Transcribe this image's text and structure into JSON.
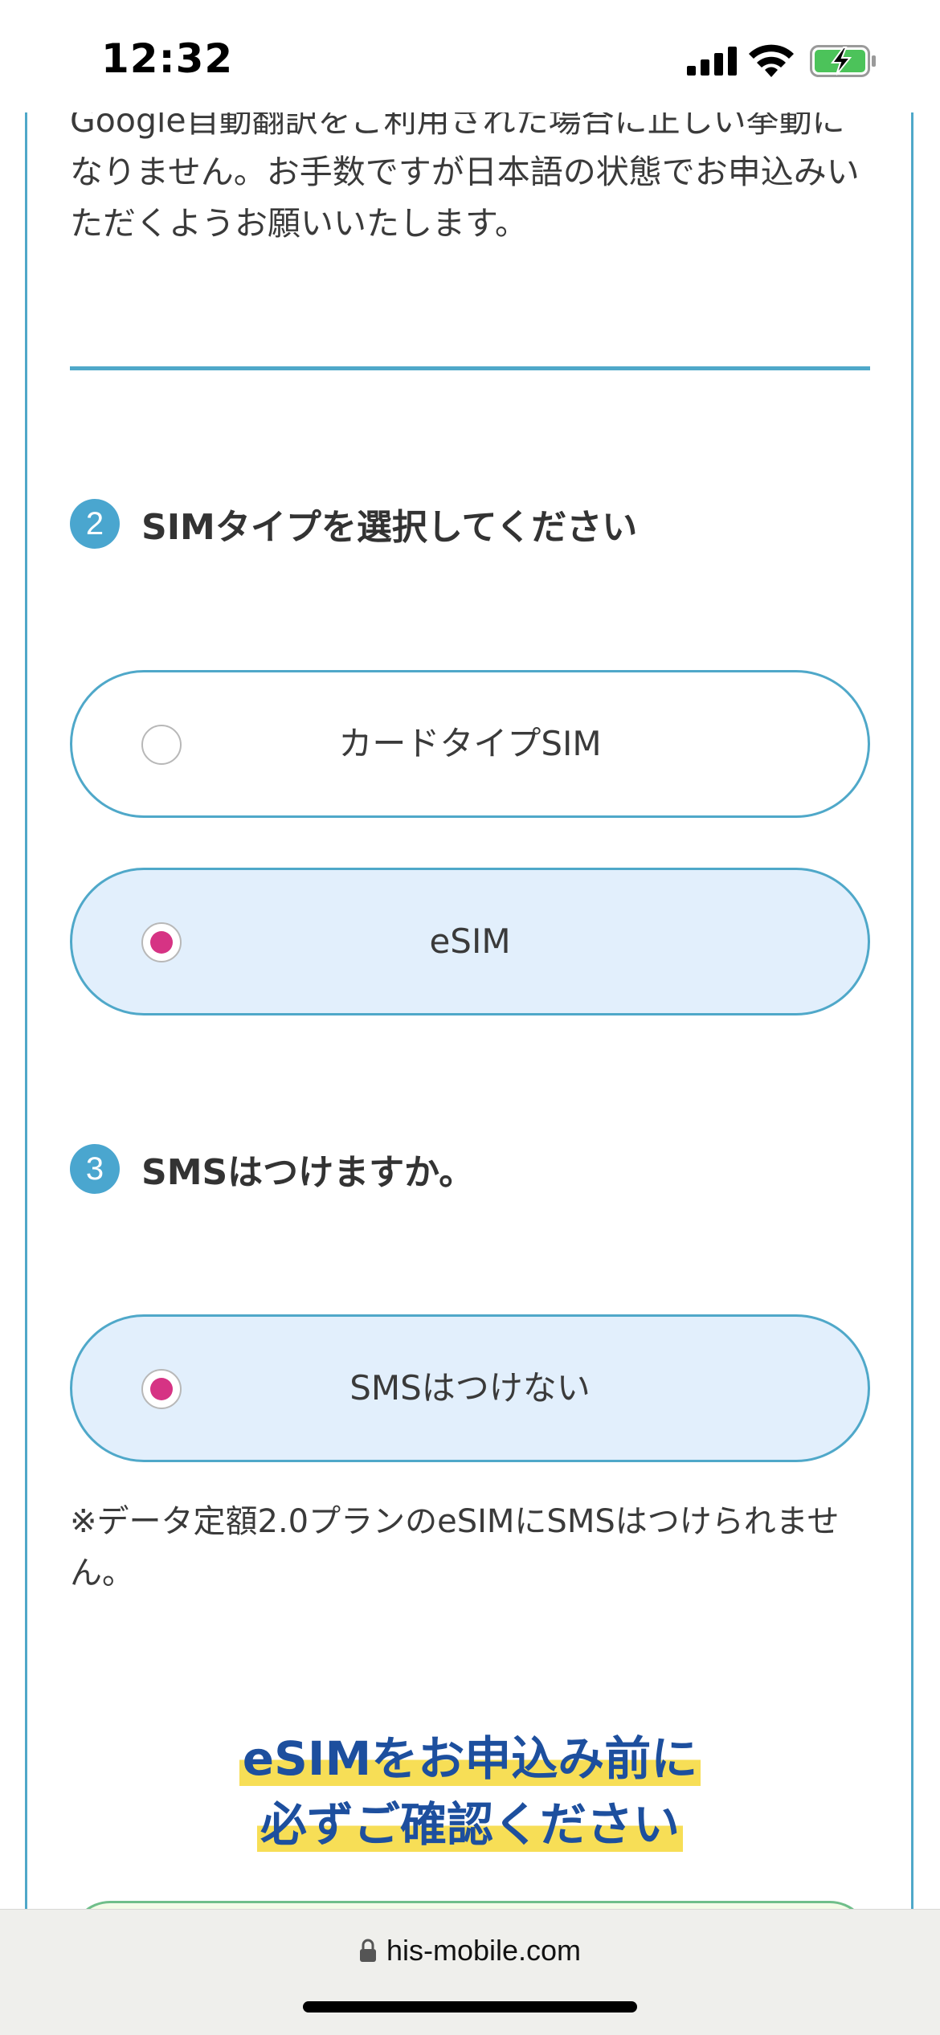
{
  "status_bar": {
    "time": "12:32"
  },
  "notice": {
    "text": "Google自動翻訳をご利用された場合に正しい挙動になりません。お手数ですが日本語の状態でお申込みいただくようお願いいたします。"
  },
  "step2": {
    "number": "2",
    "title": "SIMタイプを選択してください",
    "options": [
      {
        "label": "カードタイプSIM",
        "selected": false
      },
      {
        "label": "eSIM",
        "selected": true
      }
    ]
  },
  "step3": {
    "number": "3",
    "title": "SMSはつけますか。",
    "options": [
      {
        "label": "SMSはつけない",
        "selected": true
      }
    ],
    "note": "※データ定額2.0プランのeSIMにSMSはつけられません。"
  },
  "headline": {
    "line1": "eSIMをお申込み前に",
    "line2": "必ずご確認ください"
  },
  "browser": {
    "url": "his-mobile.com"
  },
  "colors": {
    "accent": "#4fa8c9",
    "selected_bg": "#e2effc",
    "radio_dot": "#d63384",
    "headline": "#1d4f9e",
    "highlight": "#f7de56"
  }
}
